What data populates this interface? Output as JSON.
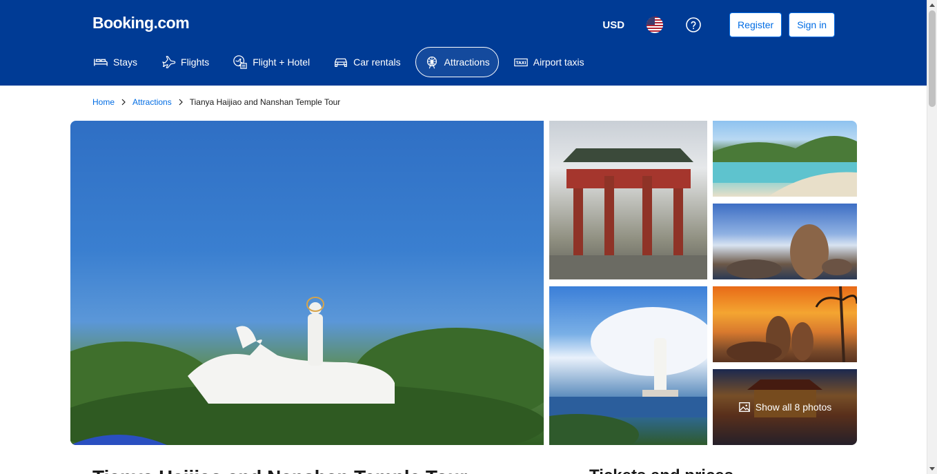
{
  "header": {
    "logo": "Booking.com",
    "currency": "USD",
    "flag_icon": "us-flag-icon",
    "help_icon": "question-circle-icon",
    "register_label": "Register",
    "signin_label": "Sign in",
    "nav": [
      {
        "label": "Stays",
        "icon": "bed-icon"
      },
      {
        "label": "Flights",
        "icon": "airplane-icon"
      },
      {
        "label": "Flight + Hotel",
        "icon": "flight-hotel-icon"
      },
      {
        "label": "Car rentals",
        "icon": "car-icon"
      },
      {
        "label": "Attractions",
        "icon": "ferris-wheel-icon",
        "active": true
      },
      {
        "label": "Airport taxis",
        "icon": "taxi-icon"
      }
    ]
  },
  "breadcrumb": {
    "home": "Home",
    "attractions": "Attractions",
    "current": "Tianya Haijiao and Nanshan Temple Tour"
  },
  "gallery": {
    "show_all_label": "Show all 8 photos",
    "photos": [
      "main-guanyin-hand-photo",
      "temple-gate-photo",
      "guanyin-statue-sea-photo",
      "beach-photo",
      "rocks-photo",
      "sunset-rocks-photo",
      "temple-photo"
    ]
  },
  "below": {
    "title_partial": "Tianya Haijiao and Nanshan Temple Tour",
    "tickets_partial": "Tickets and prices"
  },
  "colors": {
    "brand_blue": "#003b95",
    "link_blue": "#006ce4"
  }
}
